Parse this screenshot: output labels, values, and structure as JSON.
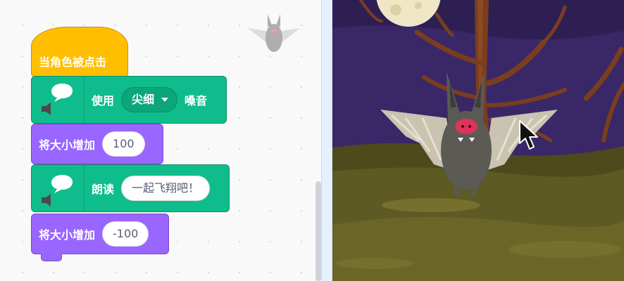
{
  "blocks": {
    "hat": {
      "label": "当角色被点击"
    },
    "tts_voice": {
      "label_prefix": "使用",
      "voice": "尖细",
      "label_suffix": "嗓音"
    },
    "change_size_1": {
      "label": "将大小增加",
      "value": "100"
    },
    "tts_speak": {
      "label": "朗读",
      "text": "一起飞翔吧！"
    },
    "change_size_2": {
      "label": "将大小增加",
      "value": "-100"
    }
  },
  "colors": {
    "events": "#ffbf00",
    "text_to_speech": "#0fbd8c",
    "looks": "#9966ff",
    "stage_sky": "#2e1f53",
    "stage_ground": "#5e5a24"
  },
  "icons": [
    "bat-sprite-icon",
    "speaker-icon",
    "speech-bubble-icon",
    "mouse-cursor-icon"
  ]
}
